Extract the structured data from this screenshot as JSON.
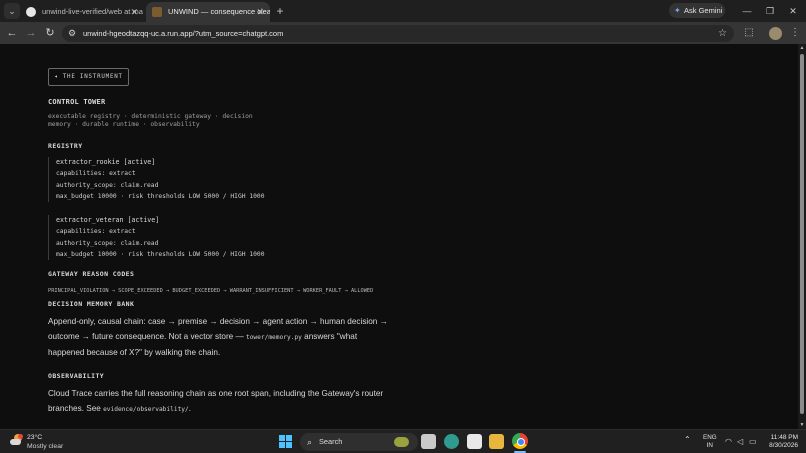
{
  "browser": {
    "tabs": [
      {
        "title": "unwind-live-verified/web at ma",
        "active": false
      },
      {
        "title": "UNWIND — consequence clea",
        "active": true
      }
    ],
    "ask_gemini": "Ask Gemini",
    "url": "unwind-hgeodtazqq-uc.a.run.app/?utm_source=chatgpt.com"
  },
  "page": {
    "back_button": "◂ THE INSTRUMENT",
    "title": "CONTROL TOWER",
    "subtitle_1": "executable registry · deterministic gateway · decision",
    "subtitle_2": "memory · durable runtime · observability",
    "registry": {
      "heading": "REGISTRY",
      "agents": [
        {
          "name": "extractor_rookie [active]",
          "capabilities": "capabilities: extract",
          "scope": "authority_scope: claim.read",
          "budget": "max_budget 10000 · risk thresholds LOW 5000 / HIGH 1000"
        },
        {
          "name": "extractor_veteran [active]",
          "capabilities": "capabilities: extract",
          "scope": "authority_scope: claim.read",
          "budget": "max_budget 10000 · risk thresholds LOW 5000 / HIGH 1000"
        }
      ]
    },
    "gateway": {
      "heading": "GATEWAY REASON CODES",
      "codes": "PRINCIPAL_VIOLATION → SCOPE_EXCEEDED → BUDGET_EXCEEDED → WARRANT_INSUFFICIENT → WORKER_FAULT → ALLOWED"
    },
    "memory": {
      "heading": "DECISION MEMORY BANK",
      "text_1": "Append-only, causal chain: case → premise → decision → agent action → human decision → outcome → future consequence. Not a vector store — ",
      "code": "tower/memory.py",
      "text_2": " answers \"what happened because of X?\" by walking the chain."
    },
    "observability": {
      "heading": "OBSERVABILITY",
      "text_1": "Cloud Trace carries the full reasoning chain as one root span, including the Gateway's router branches. See ",
      "code": "evidence/observability/",
      "text_2": "."
    }
  },
  "taskbar": {
    "temperature": "23°C",
    "condition": "Mostly clear",
    "search": "Search",
    "lang_1": "ENG",
    "lang_2": "IN",
    "time": "11:48 PM",
    "date": "8/30/2026"
  }
}
